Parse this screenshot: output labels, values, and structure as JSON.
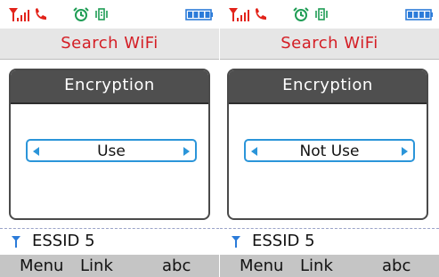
{
  "colors": {
    "title_red": "#d41e25",
    "accent_blue": "#2b95d9",
    "header_dark": "#4f4f4f",
    "softkey_gray": "#c5c5c5"
  },
  "screens": [
    {
      "status_icons": [
        "signal-icon",
        "phone-icon",
        "alarm-icon",
        "vibrate-icon",
        "battery-icon"
      ],
      "title": "Search WiFi",
      "panel_header": "Encryption",
      "selector_value": "Use",
      "network_name": "ESSID 5",
      "softkeys": [
        "Menu",
        "Link",
        "abc"
      ]
    },
    {
      "status_icons": [
        "signal-icon",
        "phone-icon",
        "alarm-icon",
        "vibrate-icon",
        "battery-icon"
      ],
      "title": "Search WiFi",
      "panel_header": "Encryption",
      "selector_value": "Not Use",
      "network_name": "ESSID 5",
      "softkeys": [
        "Menu",
        "Link",
        "abc"
      ]
    }
  ]
}
